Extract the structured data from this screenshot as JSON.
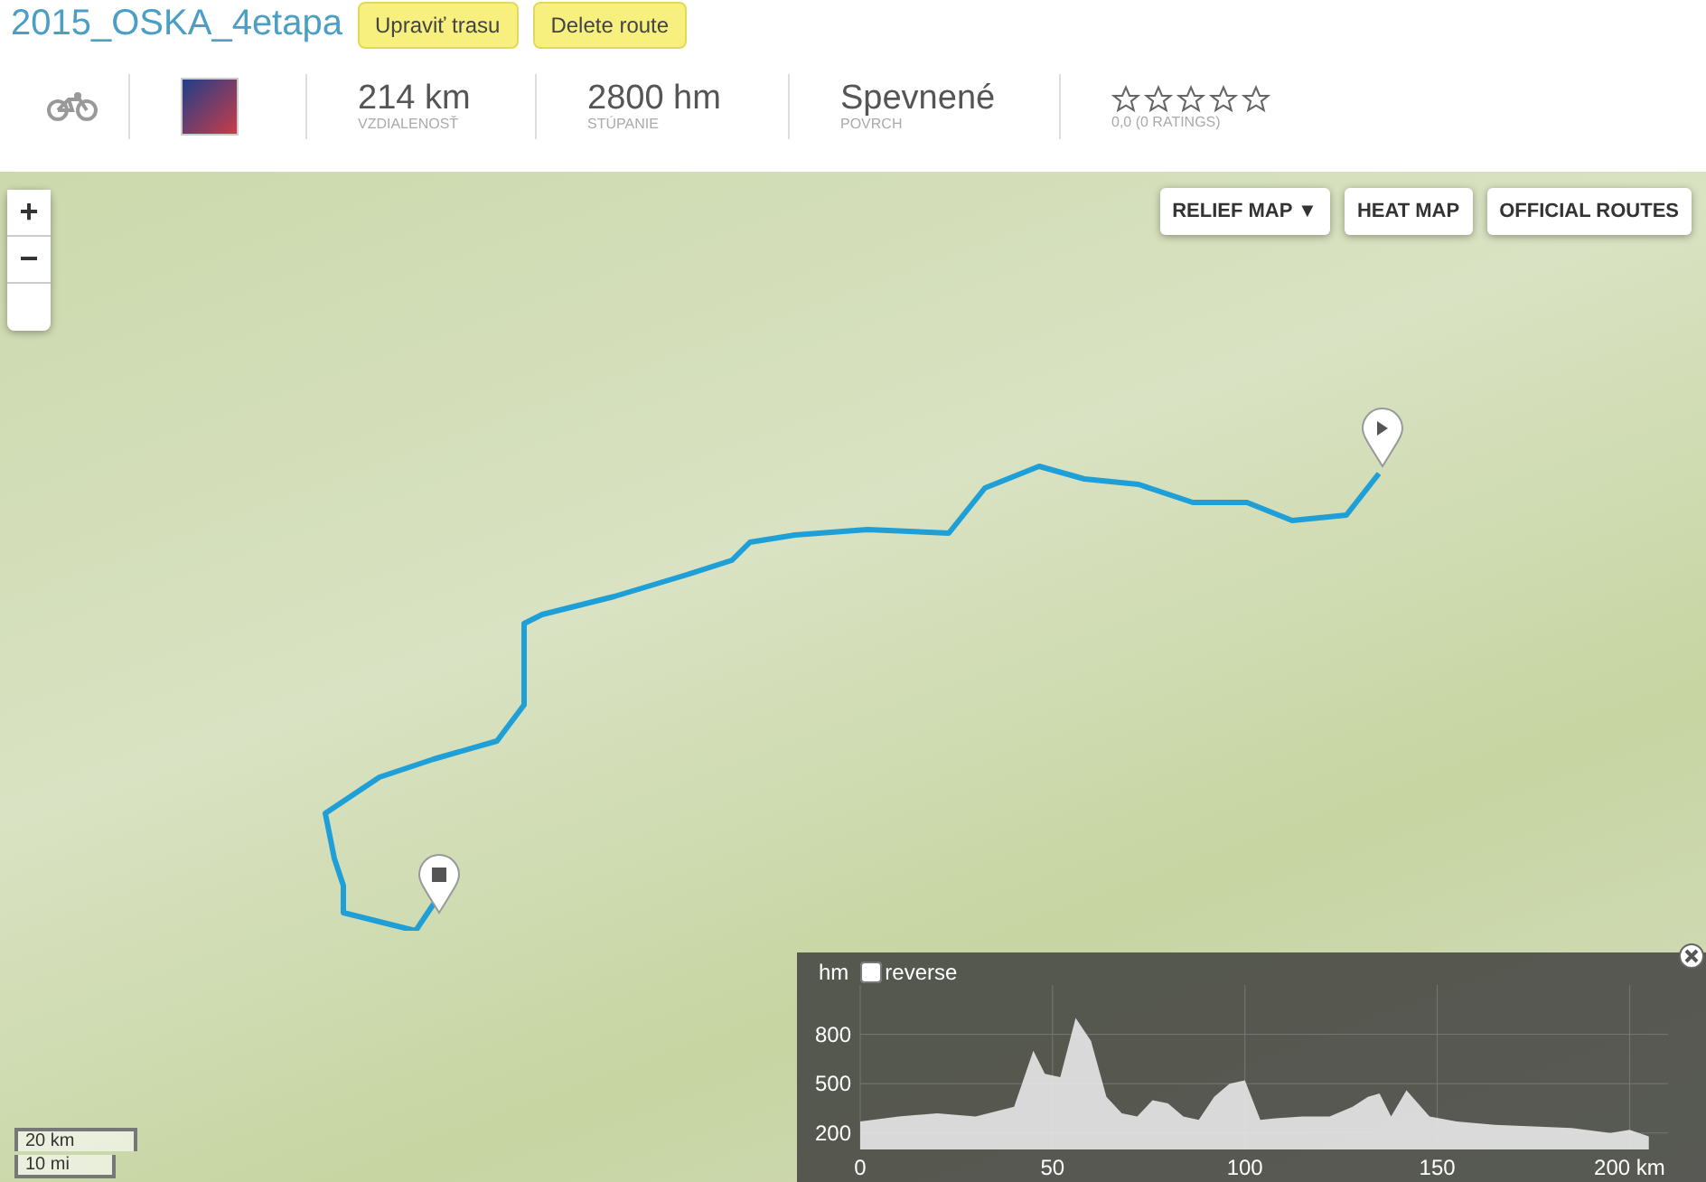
{
  "route": {
    "title": "2015_OSKA_4etapa",
    "buttons": [
      "Upraviť trasu",
      "Delete route"
    ]
  },
  "stats": [
    {
      "value": "214 km",
      "label": "VZDIALENOSŤ"
    },
    {
      "value": "2800 hm",
      "label": "STÚPANIE"
    },
    {
      "value": "Spevnené",
      "label": "POVRCH"
    }
  ],
  "rating": {
    "stars": 0,
    "text": "0,0 (0 RATINGS)"
  },
  "map": {
    "zoom_buttons": [
      "+",
      "−"
    ],
    "layer_buttons": [
      "RELIEF MAP ▼",
      "HEAT MAP",
      "OFFICIAL ROUTES"
    ],
    "scale": [
      "20 km",
      "10 mi"
    ]
  },
  "elevation": {
    "unit": "hm",
    "reverse": {
      "label": "reverse",
      "checked": false
    },
    "chart_data": {
      "type": "area",
      "grid": true,
      "xlim": [
        0,
        210
      ],
      "ylim": [
        100,
        1100
      ],
      "xticks": [
        0,
        50,
        100,
        {
          "value": 150,
          "label": "150"
        },
        {
          "value": 200,
          "label": "200 km"
        }
      ],
      "yticks": [
        200,
        500,
        800
      ],
      "x": [
        0,
        10,
        20,
        30,
        40,
        45,
        48,
        52,
        56,
        60,
        64,
        68,
        72,
        76,
        80,
        84,
        88,
        92,
        96,
        100,
        104,
        108,
        115,
        122,
        128,
        132,
        135,
        138,
        142,
        148,
        155,
        165,
        175,
        185,
        195,
        200,
        205
      ],
      "series": [
        {
          "color": "#e8e8e8",
          "values": [
            270,
            300,
            320,
            300,
            360,
            700,
            560,
            540,
            900,
            760,
            420,
            320,
            300,
            400,
            380,
            300,
            280,
            420,
            500,
            520,
            280,
            290,
            300,
            300,
            360,
            420,
            440,
            300,
            460,
            300,
            270,
            250,
            240,
            230,
            200,
            220,
            180
          ]
        }
      ]
    }
  }
}
